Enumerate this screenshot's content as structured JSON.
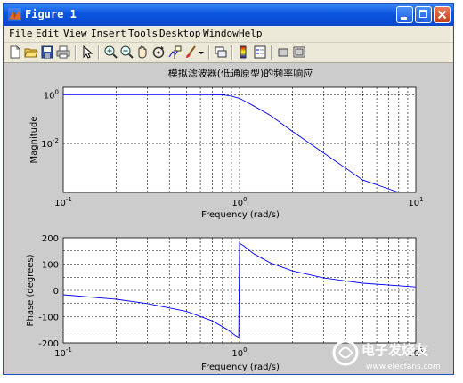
{
  "window": {
    "title": "Figure 1"
  },
  "menu": [
    "File",
    "Edit",
    "View",
    "Insert",
    "Tools",
    "Desktop",
    "Window",
    "Help"
  ],
  "toolbar_icons": [
    "new-figure-icon",
    "open-file-icon",
    "save-icon",
    "print-icon",
    "pointer-icon",
    "zoom-in-icon",
    "zoom-out-icon",
    "pan-icon",
    "rotate-icon",
    "data-cursor-icon",
    "brush-icon",
    "dropdown-arrow-icon",
    "link-icon",
    "colorbar-icon",
    "legend-icon",
    "hide-plot-tools-icon",
    "show-plot-tools-icon"
  ],
  "plot": {
    "title": "模拟滤波器(低通原型)的频率响应",
    "magnitude": {
      "ylabel": "Magnitude",
      "xlabel": "Frequency (rad/s)",
      "yticks": [
        {
          "base": "10",
          "exp": "0"
        },
        {
          "base": "10",
          "exp": "-2"
        }
      ],
      "xticks": [
        {
          "base": "10",
          "exp": "-1"
        },
        {
          "base": "10",
          "exp": "0"
        },
        {
          "base": "10",
          "exp": "1"
        }
      ]
    },
    "phase": {
      "ylabel": "Phase (degrees)",
      "xlabel": "Frequency (rad/s)",
      "yticks": [
        "200",
        "100",
        "0",
        "-100",
        "-200"
      ],
      "xticks": [
        {
          "base": "10",
          "exp": "-1"
        },
        {
          "base": "10",
          "exp": "0"
        },
        {
          "base": "10",
          "exp": "1"
        }
      ]
    }
  },
  "watermark": {
    "text_cn": "电子发烧友",
    "text_en": "www.elecfans.com"
  },
  "chart_data": [
    {
      "type": "line",
      "xscale": "log",
      "yscale": "log",
      "xlim": [
        0.1,
        10
      ],
      "ylim": [
        0.0001,
        2
      ],
      "x": [
        0.1,
        0.2,
        0.4,
        0.6,
        0.8,
        0.9,
        1.0,
        1.2,
        1.5,
        2,
        3,
        5,
        8
      ],
      "y": [
        1.0,
        1.0,
        1.0,
        1.0,
        0.99,
        0.87,
        0.707,
        0.35,
        0.14,
        0.031,
        0.0041,
        0.00032,
        3e-05
      ],
      "grid": true,
      "color": "#0000ff"
    },
    {
      "type": "line",
      "xscale": "log",
      "yscale": "linear",
      "xlim": [
        0.1,
        10
      ],
      "ylim": [
        -200,
        200
      ],
      "x": [
        0.1,
        0.2,
        0.3,
        0.5,
        0.7,
        0.85,
        0.95,
        0.99,
        1.0,
        1.01,
        1.05,
        1.2,
        1.5,
        2,
        3,
        5,
        10
      ],
      "y": [
        -17,
        -34,
        -50,
        -80,
        -116,
        -148,
        -172,
        -179,
        180,
        177,
        171,
        140,
        104,
        74,
        47,
        27,
        13
      ],
      "grid": true,
      "color": "#0000ff"
    }
  ]
}
